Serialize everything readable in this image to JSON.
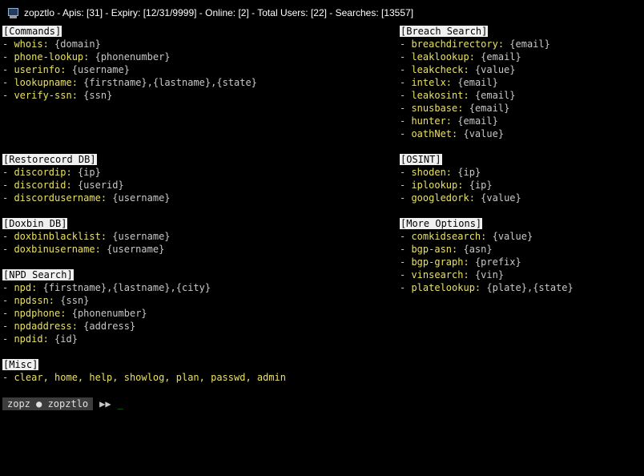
{
  "window": {
    "title": "zopztlo - Apis: [31] - Expiry: [12/31/9999] - Online: [2] - Total Users: [22] - Searches: [13557]"
  },
  "left_sections": [
    {
      "header": "[Commands]",
      "items": [
        {
          "cmd": "whois:",
          "arg": "{domain}"
        },
        {
          "cmd": "phone-lookup:",
          "arg": "{phonenumber}"
        },
        {
          "cmd": "userinfo:",
          "arg": "{username}"
        },
        {
          "cmd": "lookupname:",
          "arg": "{firstname},{lastname},{state}"
        },
        {
          "cmd": "verify-ssn:",
          "arg": "{ssn}"
        }
      ]
    },
    {
      "header": "[Restorecord DB]",
      "items": [
        {
          "cmd": "discordip:",
          "arg": "{ip}"
        },
        {
          "cmd": "discordid:",
          "arg": "{userid}"
        },
        {
          "cmd": "discordusername:",
          "arg": "{username}"
        }
      ]
    },
    {
      "header": "[Doxbin DB]",
      "items": [
        {
          "cmd": "doxbinblacklist:",
          "arg": "{username}"
        },
        {
          "cmd": "doxbinusername:",
          "arg": "{username}"
        }
      ]
    },
    {
      "header": "[NPD Search]",
      "items": [
        {
          "cmd": "npd:",
          "arg": "{firstname},{lastname},{city}"
        },
        {
          "cmd": "npdssn:",
          "arg": "{ssn}"
        },
        {
          "cmd": "npdphone:",
          "arg": "{phonenumber}"
        },
        {
          "cmd": "npdaddress:",
          "arg": "{address}"
        },
        {
          "cmd": "npdid:",
          "arg": "{id}"
        }
      ]
    },
    {
      "header": "[Misc]",
      "items": [
        {
          "cmd": "clear, home, help, showlog, plan, passwd, admin",
          "arg": ""
        }
      ]
    }
  ],
  "right_sections": [
    {
      "header": "[Breach Search]",
      "items": [
        {
          "cmd": "breachdirectory:",
          "arg": "{email}"
        },
        {
          "cmd": "leaklookup:",
          "arg": "{email}"
        },
        {
          "cmd": "leakcheck:",
          "arg": "{value}"
        },
        {
          "cmd": "intelx:",
          "arg": "{email}"
        },
        {
          "cmd": "leakosint:",
          "arg": "{email}"
        },
        {
          "cmd": "snusbase:",
          "arg": "{email}"
        },
        {
          "cmd": "hunter:",
          "arg": "{email}"
        },
        {
          "cmd": "oathNet:",
          "arg": "{value}"
        }
      ]
    },
    {
      "header": "[OSINT]",
      "items": [
        {
          "cmd": "shoden:",
          "arg": "{ip}"
        },
        {
          "cmd": "iplookup:",
          "arg": "{ip}"
        },
        {
          "cmd": "googledork:",
          "arg": "{value}"
        }
      ]
    },
    {
      "header": "[More Options]",
      "items": [
        {
          "cmd": "comkidsearch:",
          "arg": "{value}"
        },
        {
          "cmd": "bgp-asn:",
          "arg": "{asn}"
        },
        {
          "cmd": "bgp-graph:",
          "arg": "{prefix}"
        },
        {
          "cmd": "vinsearch:",
          "arg": "{vin}"
        },
        {
          "cmd": "platelookup:",
          "arg": "{plate},{state}"
        }
      ]
    }
  ],
  "prompt": {
    "label": "zopz ● zopztlo",
    "arrow": "▶▶",
    "cursor": "_"
  },
  "colors": {
    "background": "#000000",
    "command": "#e8e066",
    "text": "#c8c8c8",
    "header_bg": "#f0f0f0",
    "cursor": "#13a10e"
  },
  "icons": {
    "window_icon": "terminal-app-icon"
  }
}
